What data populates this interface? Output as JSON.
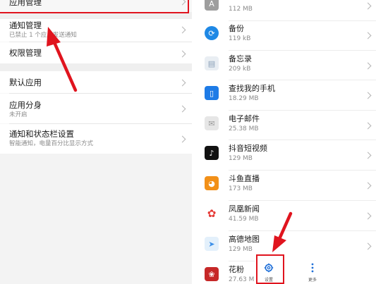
{
  "left": {
    "app_manage": "应用管理",
    "notify_manage": {
      "title": "通知管理",
      "subtitle": "已禁止 1 个应用发送通知"
    },
    "permission_manage": "权限管理",
    "default_apps": "默认应用",
    "app_twin": {
      "title": "应用分身",
      "subtitle": "未开启"
    },
    "notify_statusbar": {
      "title": "通知和状态栏设置",
      "subtitle": "智能通知，电量百分比显示方式"
    }
  },
  "right": {
    "apps": [
      {
        "name": "A",
        "size": "112 MB",
        "icon": "a-app-icon",
        "color": "#9e9e9e"
      },
      {
        "name": "备份",
        "size": "119 kB",
        "icon": "backup-icon",
        "color": "#1e88e5"
      },
      {
        "name": "备忘录",
        "size": "209 kB",
        "icon": "memo-icon",
        "color": "#e9eef3"
      },
      {
        "name": "查找我的手机",
        "size": "18.29 MB",
        "icon": "find-phone-icon",
        "color": "#1e7be6"
      },
      {
        "name": "电子邮件",
        "size": "25.38 MB",
        "icon": "email-icon",
        "color": "#e0e0e0"
      },
      {
        "name": "抖音短视频",
        "size": "129 MB",
        "icon": "douyin-icon",
        "color": "#111111"
      },
      {
        "name": "斗鱼直播",
        "size": "173 MB",
        "icon": "douyu-icon",
        "color": "#f29018"
      },
      {
        "name": "凤凰新闻",
        "size": "41.59 MB",
        "icon": "ifeng-icon",
        "color": "#e53935"
      },
      {
        "name": "高德地图",
        "size": "129 MB",
        "icon": "amap-icon",
        "color": "#3b8fe8"
      },
      {
        "name": "花粉",
        "size": "27.63 MB",
        "icon": "huafen-icon",
        "color": "#c62828"
      }
    ],
    "nav": {
      "settings": "设置",
      "more": "更多"
    }
  }
}
